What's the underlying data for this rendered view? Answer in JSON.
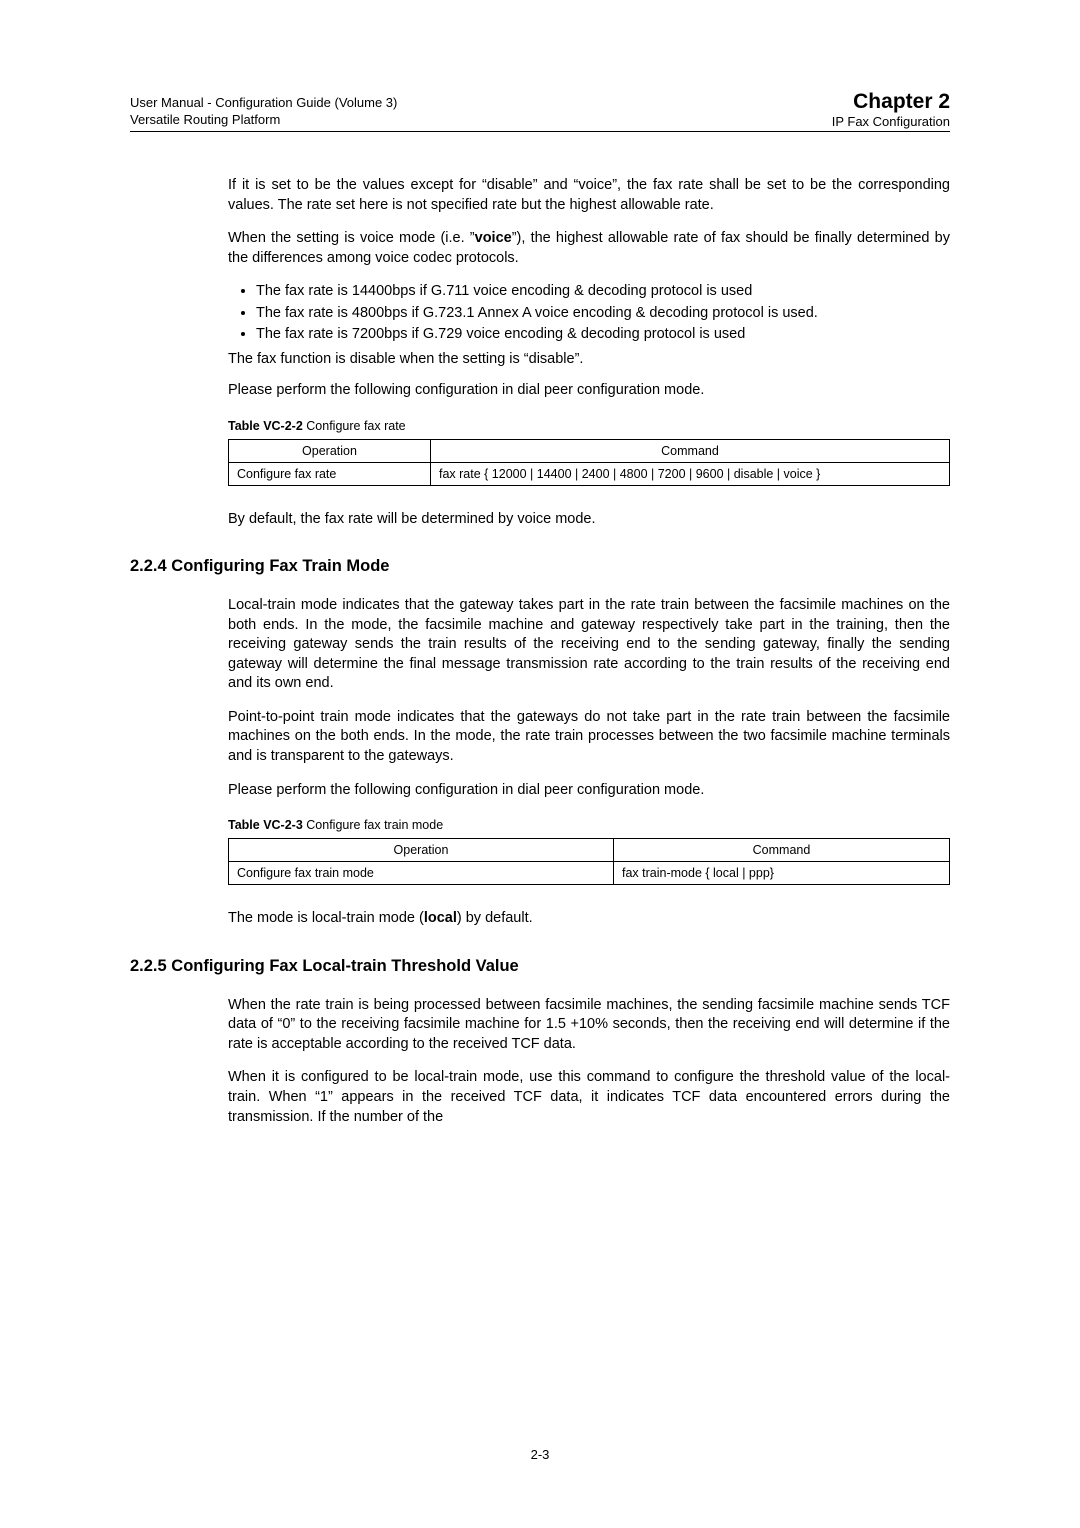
{
  "header": {
    "left_line1": "User Manual - Configuration Guide (Volume 3)",
    "left_line2": "Versatile Routing Platform",
    "chapter": "Chapter 2",
    "subchapter": "IP Fax Configuration"
  },
  "paras": {
    "p1": "If it is set to be the values except for “disable” and “voice”, the fax rate shall be set to be the corresponding values. The rate set here is not specified rate but the highest allowable rate.",
    "p2_pre": "When the setting is voice mode (i.e. ”",
    "p2_bold": "voice",
    "p2_post": "”), the highest allowable rate of fax should be finally determined by the differences among voice codec protocols.",
    "b1": "The fax rate is 14400bps if G.711 voice encoding & decoding protocol is used",
    "b2": "The fax rate is 4800bps if G.723.1 Annex A voice encoding & decoding protocol is used.",
    "b3": "The fax rate is 7200bps if G.729 voice encoding & decoding protocol is used",
    "p3": "The fax function is disable when the setting is “disable”.",
    "p4": "Please perform the following configuration in dial peer configuration mode.",
    "p5": "By default, the fax rate will be determined by voice mode.",
    "p6": "Local-train mode indicates that the gateway takes part in the rate train between the facsimile machines on the both ends. In the mode, the facsimile machine and gateway respectively take part in the training, then the receiving gateway sends the train results of the receiving end to the sending gateway, finally the sending gateway will determine the final message transmission rate according to the train results of the receiving end and its own end.",
    "p7": "Point-to-point train mode indicates that the gateways do not take part in the rate train between the facsimile machines on the both ends. In the mode, the rate train processes between the two facsimile machine terminals and is transparent to the gateways.",
    "p8": "Please perform the following configuration in dial peer configuration mode.",
    "p9_pre": "The mode is local-train mode (",
    "p9_bold": "local",
    "p9_post": ") by default.",
    "p10": "When the rate train is being processed between facsimile machines, the sending facsimile machine sends TCF data of “0” to the receiving facsimile machine for 1.5 +10% seconds, then the receiving end will determine if the rate is acceptable according to the received TCF data.",
    "p11": "When it is configured to be local-train mode, use this command to configure the threshold value of the local-train. When “1” appears in the received TCF data, it indicates TCF data encountered errors during the transmission. If the number of the"
  },
  "tables": {
    "t1": {
      "caption_prefix": "Table VC-2-2 ",
      "caption_text": " Configure fax rate",
      "h_op": "Operation",
      "h_cmd": "Command",
      "r_op": "Configure fax rate",
      "r_cmd": "fax rate { 12000 | 14400 | 2400 | 4800 | 7200 | 9600 | disable | voice }"
    },
    "t2": {
      "caption_prefix": "Table VC-2-3 ",
      "caption_text": " Configure fax train mode",
      "h_op": "Operation",
      "h_cmd": "Command",
      "r_op": "Configure fax train mode",
      "r_cmd": "fax train-mode { local | ppp}"
    }
  },
  "sections": {
    "s224": "2.2.4  Configuring Fax Train Mode",
    "s225": "2.2.5  Configuring Fax Local-train Threshold Value"
  },
  "footer": {
    "page_num": "2-3"
  }
}
